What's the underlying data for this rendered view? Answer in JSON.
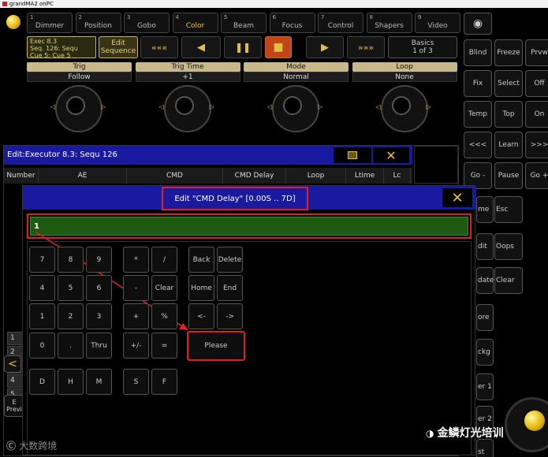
{
  "titlebar": {
    "title": "grandMA2 onPC"
  },
  "pools": [
    {
      "num": "1",
      "label": "Dimmer"
    },
    {
      "num": "2",
      "label": "Position"
    },
    {
      "num": "3",
      "label": "Gobo"
    },
    {
      "num": "4",
      "label": "Color"
    },
    {
      "num": "5",
      "label": "Beam"
    },
    {
      "num": "6",
      "label": "Focus"
    },
    {
      "num": "7",
      "label": "Control"
    },
    {
      "num": "8",
      "label": "Shapers"
    },
    {
      "num": "9",
      "label": "Video"
    }
  ],
  "exec_info": {
    "line1": "Exec 8.3",
    "line2": "Seq. 126: Sequ",
    "line3": "Cue 5: Cue 5"
  },
  "edit_sequence": {
    "line1": "Edit",
    "line2": "Sequence"
  },
  "basics": {
    "line1": "Basics",
    "line2": "1 of 3"
  },
  "transport": {
    "rewind_icon": "«««",
    "prev_icon": "◀",
    "pause_icon": "❚❚",
    "stop_icon": "■",
    "play_icon": "▶",
    "ff_icon": "»»»"
  },
  "encoders": [
    {
      "label": "Trig",
      "value": "Follow"
    },
    {
      "label": "Trig Time",
      "value": "+1"
    },
    {
      "label": "Mode",
      "value": "Normal"
    },
    {
      "label": "Loop",
      "value": "None"
    }
  ],
  "right_panel": {
    "rows": [
      [
        "Blind",
        "Freeze",
        "Prvw"
      ],
      [
        "Fix",
        "Select",
        "Off"
      ],
      [
        "Temp",
        "Top",
        "On"
      ],
      [
        "<<<",
        "Learn",
        ">>>"
      ],
      [
        "Go -",
        "Pause",
        "Go +"
      ]
    ],
    "partial": [
      "me",
      "Esc",
      "dit",
      "Oops",
      "date",
      "Clear",
      "ore",
      "ckg",
      "er 1",
      "er 2",
      "st"
    ]
  },
  "executor_window": {
    "title": "Edit:Executor 8.3: Sequ 126",
    "columns": [
      "Number",
      "AE",
      "CMD",
      "CMD Delay",
      "Loop",
      "Ltime",
      "Lc"
    ],
    "rows": [
      "1",
      "2",
      "3",
      "4",
      "5"
    ]
  },
  "dialog": {
    "title": "Edit \"CMD Delay\" [0.00S .. 7D]",
    "input_value": "1",
    "keys": {
      "n7": "7",
      "n8": "8",
      "n9": "9",
      "times": "*",
      "div": "/",
      "back": "Back",
      "delete": "Delete",
      "n4": "4",
      "n5": "5",
      "n6": "6",
      "minus": "-",
      "clear": "Clear",
      "home": "Home",
      "end": "End",
      "n1": "1",
      "n2": "2",
      "n3": "3",
      "plus": "+",
      "pct": "%",
      "left": "<-",
      "right": "->",
      "n0": "0",
      "dot": ".",
      "thru": "Thru",
      "plusminus": "+/-",
      "eq": "=",
      "please": "Please",
      "D": "D",
      "H": "H",
      "M": "M",
      "S": "S",
      "F": "F"
    }
  },
  "left_side": {
    "back_arrow": "<",
    "previ_label1": "E",
    "previ_label2": "Previ"
  },
  "watermark": {
    "left": "大数跨境",
    "right": "金鳞灯光培训"
  },
  "colors": {
    "accent_yellow": "#e6c040",
    "dialog_blue": "#1a1aa0",
    "input_green": "#1e5a12",
    "highlight_red": "#dd2222",
    "stop_orange": "#c0461a"
  }
}
